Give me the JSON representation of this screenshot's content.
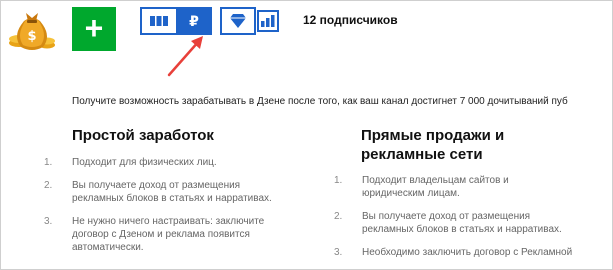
{
  "header": {
    "add_label": "+",
    "money_tab_symbol": "₽",
    "subscribers": "12 подписчиков",
    "icons": {
      "logo": "money-bag-icon",
      "cards": "columns-icon",
      "diamond": "diamond-icon",
      "stats": "bar-chart-icon",
      "arrow": "red-arrow-annotation"
    },
    "colors": {
      "accent": "#1e63c9",
      "add_button": "#00a82d",
      "arrow": "#e8403a"
    }
  },
  "intro": "Получите возможность зарабатывать в Дзене после того, как ваш канал достигнет 7 000 дочитываний пуб",
  "columns": [
    {
      "title": "Простой заработок",
      "items": [
        {
          "num": "1.",
          "text": "Подходит для физических лиц."
        },
        {
          "num": "2.",
          "text": "Вы получаете доход от размещения рекламных блоков в статьях и нарративах."
        },
        {
          "num": "3.",
          "text": "Не нужно ничего настраивать: заключите договор с Дзеном и реклама появится автоматически."
        }
      ]
    },
    {
      "title": "Прямые продажи и рекламные сети",
      "items": [
        {
          "num": "1.",
          "text": "Подходит владельцам сайтов и юридическим лицам."
        },
        {
          "num": "2.",
          "text": "Вы получаете доход от размещения рекламных блоков в статьях и нарративах."
        },
        {
          "num": "3.",
          "text": "Необходимо заключить договор с Рекламной"
        }
      ]
    }
  ]
}
